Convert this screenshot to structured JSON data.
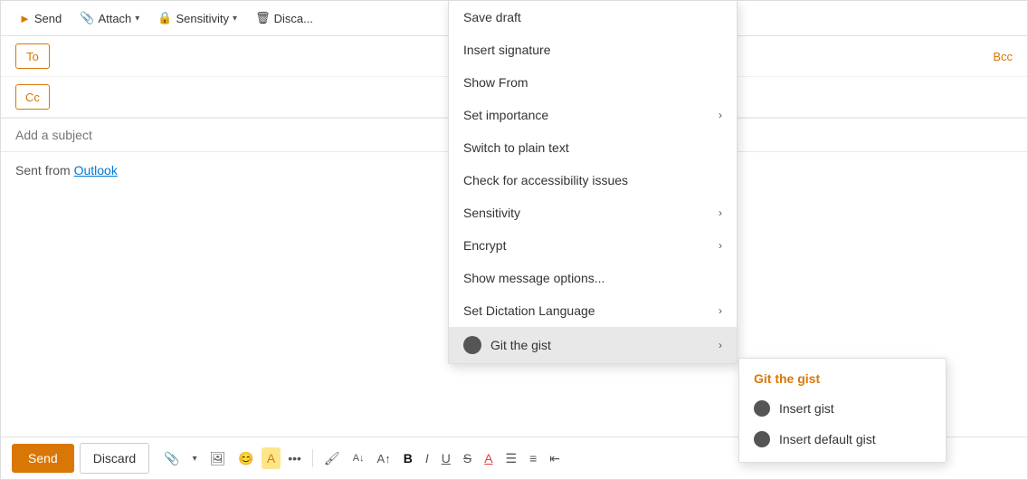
{
  "toolbar": {
    "send_label": "Send",
    "attach_label": "Attach",
    "sensitivity_label": "Sensitivity",
    "discard_label": "Disca..."
  },
  "fields": {
    "to_label": "To",
    "cc_label": "Cc",
    "bcc_label": "Bcc",
    "subject_placeholder": "Add a subject"
  },
  "body": {
    "sent_from_text": "Sent from ",
    "outlook_link": "Outlook"
  },
  "bottom_toolbar": {
    "send_label": "Send",
    "discard_label": "Discard"
  },
  "dropdown_menu": {
    "items": [
      {
        "label": "Save draft",
        "hasSubmenu": false
      },
      {
        "label": "Insert signature",
        "hasSubmenu": false
      },
      {
        "label": "Show From",
        "hasSubmenu": false
      },
      {
        "label": "Set importance",
        "hasSubmenu": true
      },
      {
        "label": "Switch to plain text",
        "hasSubmenu": false
      },
      {
        "label": "Check for accessibility issues",
        "hasSubmenu": false
      },
      {
        "label": "Sensitivity",
        "hasSubmenu": true
      },
      {
        "label": "Encrypt",
        "hasSubmenu": true
      },
      {
        "label": "Show message options...",
        "hasSubmenu": false
      },
      {
        "label": "Set Dictation Language",
        "hasSubmenu": true
      },
      {
        "label": "Git the gist",
        "hasSubmenu": true,
        "active": true
      }
    ]
  },
  "submenu": {
    "title": "Git the gist",
    "items": [
      {
        "label": "Insert gist"
      },
      {
        "label": "Insert default gist"
      }
    ]
  },
  "format_icons": {
    "paint": "🖌",
    "font_size_down": "A",
    "font_size_up": "A",
    "bold": "B",
    "italic": "I",
    "underline": "U",
    "strikethrough": "S",
    "font_color": "A",
    "bullets": "≡",
    "numbering": "≡",
    "indent": "⇥",
    "attach": "📎",
    "image": "🖼",
    "emoji": "😊",
    "highlight": "A",
    "more": "..."
  }
}
